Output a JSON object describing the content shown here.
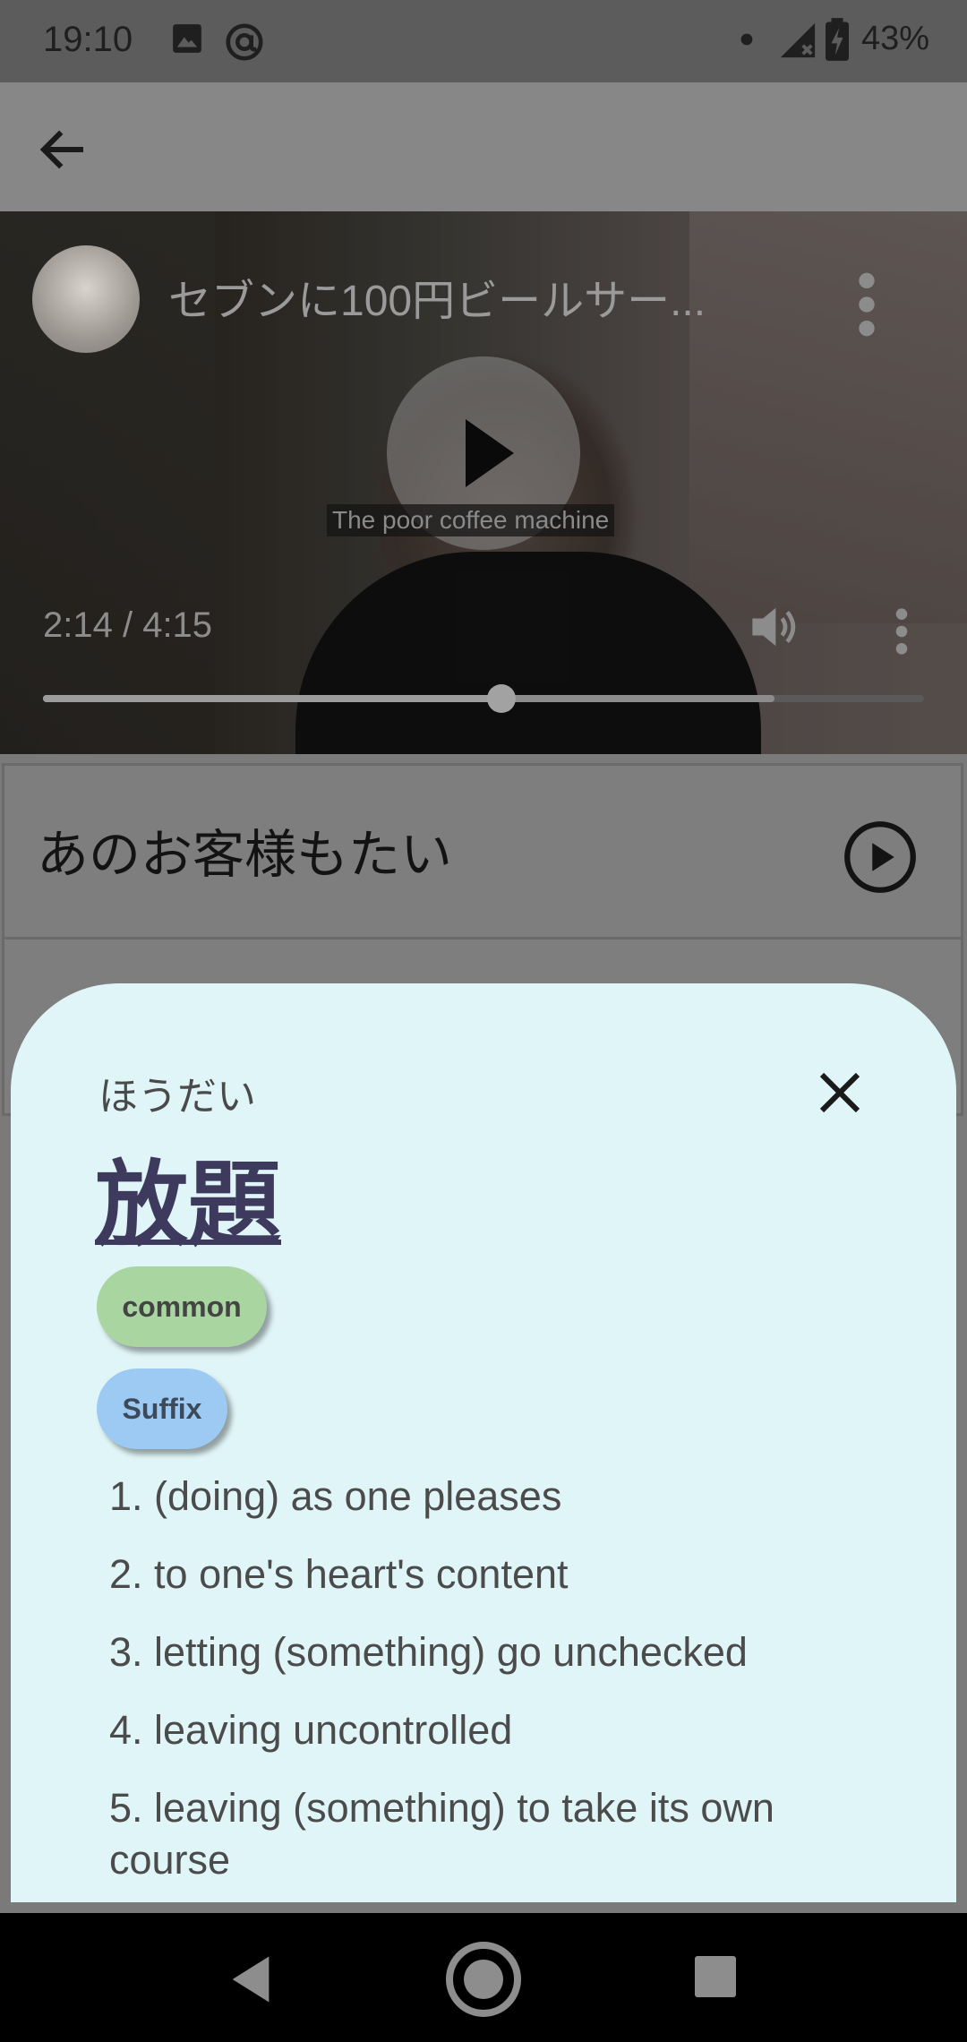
{
  "status_bar": {
    "time": "19:10",
    "battery": "43%",
    "icons": [
      "image-icon",
      "at-sign-icon",
      "dot-icon",
      "signal-icon",
      "battery-charging-icon"
    ]
  },
  "app_bar": {
    "back_icon": "arrow-left-icon"
  },
  "video": {
    "title": "セブンに100円ビールサー...",
    "caption": "The poor coffee machine",
    "time": "2:14 / 4:15",
    "progress": 0.52,
    "buffered": 0.83
  },
  "sentences": [
    {
      "text": "あのお客様もたい"
    }
  ],
  "definition": {
    "reading": "ほうだい",
    "word": "放題",
    "tags": {
      "frequency": "common",
      "pos": "Suffix"
    },
    "meanings": [
      "1. (doing) as one pleases",
      "2. to one's heart's content",
      "3. letting (something) go unchecked",
      "4. leaving uncontrolled",
      "5. leaving (something) to take its own course"
    ]
  },
  "nav_bar": {
    "icons": [
      "back-triangle-icon",
      "home-circle-icon",
      "recents-square-icon"
    ]
  },
  "colors": {
    "sheet_bg": "#e0f5f7",
    "tag_common": "#a8d5a0",
    "tag_pos": "#9ccaf3",
    "kanji": "#3e3a5e"
  }
}
